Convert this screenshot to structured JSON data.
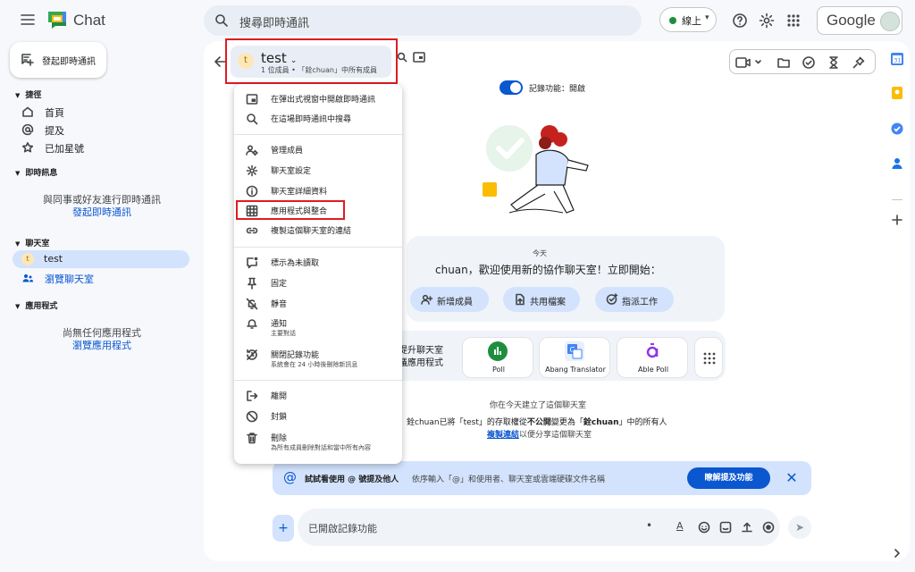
{
  "app": {
    "name": "Chat"
  },
  "search": {
    "placeholder": "搜尋即時通訊"
  },
  "status": {
    "label": "線上",
    "color": "#1e8e3e"
  },
  "account": {
    "brand": "Google"
  },
  "sidebar": {
    "new_chat": "發起即時通訊",
    "shortcuts": {
      "header": "捷徑",
      "items": [
        {
          "label": "首頁"
        },
        {
          "label": "提及"
        },
        {
          "label": "已加星號"
        }
      ]
    },
    "dm": {
      "header": "即時訊息",
      "empty": "與同事或好友進行即時通訊",
      "link": "發起即時通訊"
    },
    "spaces": {
      "header": "聊天室",
      "items": [
        {
          "label": "test",
          "initial": "t"
        },
        {
          "label": "瀏覽聊天室"
        }
      ]
    },
    "apps": {
      "header": "應用程式",
      "empty": "尚無任何應用程式",
      "link": "瀏覽應用程式"
    }
  },
  "room": {
    "title": "test",
    "avatar": "t",
    "subtitle": "1 位成員 • 「銓chuan」中所有成員"
  },
  "history": {
    "label": "記錄功能：開啟"
  },
  "welcome": {
    "date": "今天",
    "text": "chuan，歡迎使用新的協作聊天室！立即開始：",
    "buttons": [
      {
        "label": "新增成員"
      },
      {
        "label": "共用檔案"
      },
      {
        "label": "指派工作"
      }
    ]
  },
  "apps_suggest": {
    "line1": "提升聊天室",
    "line2": "議應用程式",
    "apps": [
      {
        "label": "Poll"
      },
      {
        "label": "Abang Translator"
      },
      {
        "label": "Able Poll"
      }
    ]
  },
  "system": {
    "created": "你在今天建立了這個聊天室",
    "access_pre": "銓chuan已將「test」的存取權從",
    "access_from": "不公開",
    "access_mid": "變更為「",
    "access_to": "銓chuan",
    "access_post": "」中的所有人",
    "link_label": "複製連結",
    "link_post": "以便分享這個聊天室"
  },
  "tip": {
    "title": "試試看使用 @ 號提及他人",
    "desc": "依序輸入「@」和使用者、聊天室或雲端硬碟文件名稱",
    "button": "瞭解提及功能"
  },
  "composer": {
    "placeholder": "已開啟記錄功能"
  },
  "menu": {
    "items": [
      {
        "label": "在彈出式視窗中開啟即時通訊"
      },
      {
        "label": "在這場即時通訊中搜尋"
      },
      {
        "label": "管理成員"
      },
      {
        "label": "聊天室設定"
      },
      {
        "label": "聊天室詳細資料"
      },
      {
        "label": "應用程式與整合"
      },
      {
        "label": "複製這個聊天室的連結"
      },
      {
        "label": "標示為未讀取"
      },
      {
        "label": "固定"
      },
      {
        "label": "靜音"
      },
      {
        "label": "通知",
        "sub": "主要對話"
      },
      {
        "label": "關閉記錄功能",
        "sub": "系統會在 24 小時後刪除新訊息"
      },
      {
        "label": "離開"
      },
      {
        "label": "封鎖"
      },
      {
        "label": "刪除",
        "sub": "為所有成員刪除對話和當中所有內容"
      }
    ]
  },
  "colors": {
    "accent": "#0b57d0",
    "highlight_border": "#e01b22",
    "selected": "#d3e3fd"
  }
}
